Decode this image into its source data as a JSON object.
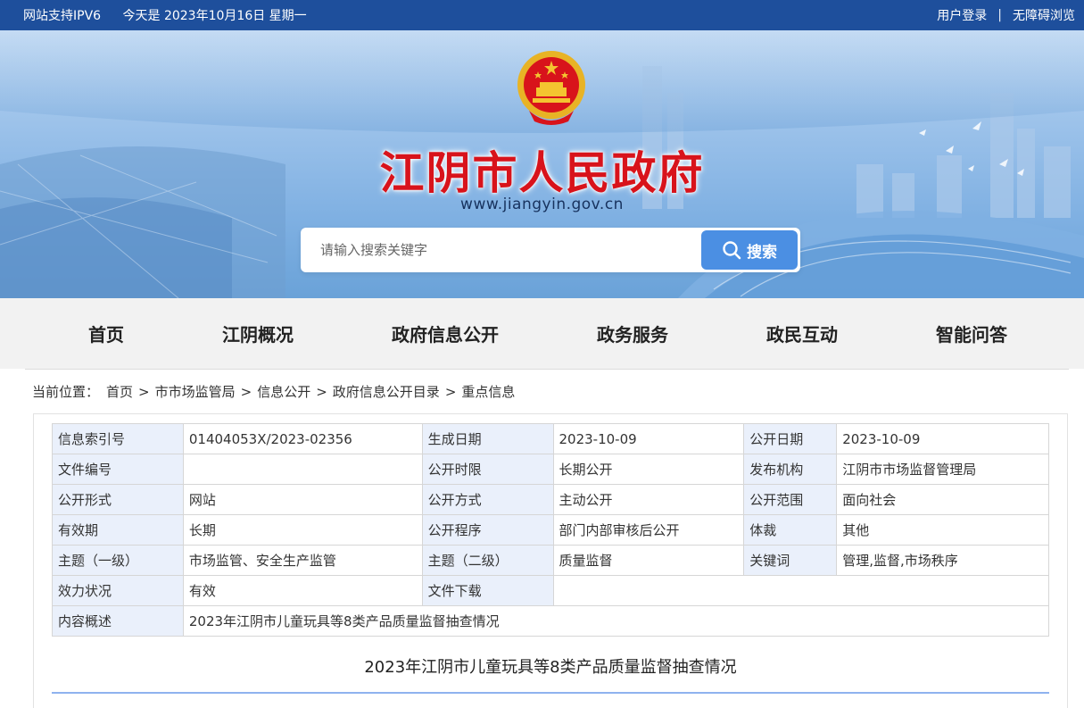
{
  "topbar": {
    "ipv6": "网站支持IPV6",
    "date": "今天是 2023年10月16日 星期一",
    "login": "用户登录",
    "separator": "|",
    "accessibility": "无障碍浏览"
  },
  "banner": {
    "title": "江阴市人民政府",
    "url": "www.jiangyin.gov.cn"
  },
  "search": {
    "placeholder": "请输入搜索关键字",
    "button": "搜索"
  },
  "nav": {
    "items": [
      "首页",
      "江阴概况",
      "政府信息公开",
      "政务服务",
      "政民互动",
      "智能问答"
    ]
  },
  "breadcrumb": {
    "prefix": "当前位置：",
    "items": [
      "首页",
      "市市场监管局",
      "信息公开",
      "政府信息公开目录",
      "重点信息"
    ],
    "arrow": ">"
  },
  "meta": {
    "index_label": "信息索引号",
    "index_value": "01404053X/2023-02356",
    "gen_date_label": "生成日期",
    "gen_date_value": "2023-10-09",
    "pub_date_label": "公开日期",
    "pub_date_value": "2023-10-09",
    "doc_no_label": "文件编号",
    "doc_no_value": "",
    "time_limit_label": "公开时限",
    "time_limit_value": "长期公开",
    "publisher_label": "发布机构",
    "publisher_value": "江阴市市场监督管理局",
    "form_label": "公开形式",
    "form_value": "网站",
    "method_label": "公开方式",
    "method_value": "主动公开",
    "scope_label": "公开范围",
    "scope_value": "面向社会",
    "validity_label": "有效期",
    "validity_value": "长期",
    "procedure_label": "公开程序",
    "procedure_value": "部门内部审核后公开",
    "genre_label": "体裁",
    "genre_value": "其他",
    "topic1_label": "主题（一级）",
    "topic1_value": "市场监管、安全生产监管",
    "topic2_label": "主题（二级）",
    "topic2_value": "质量监督",
    "keywords_label": "关键词",
    "keywords_value": "管理,监督,市场秩序",
    "status_label": "效力状况",
    "status_value": "有效",
    "download_label": "文件下载",
    "summary_label": "内容概述",
    "summary_value": "2023年江阴市儿童玩具等8类产品质量监督抽查情况"
  },
  "article": {
    "title": "2023年江阴市儿童玩具等8类产品质量监督抽查情况"
  }
}
